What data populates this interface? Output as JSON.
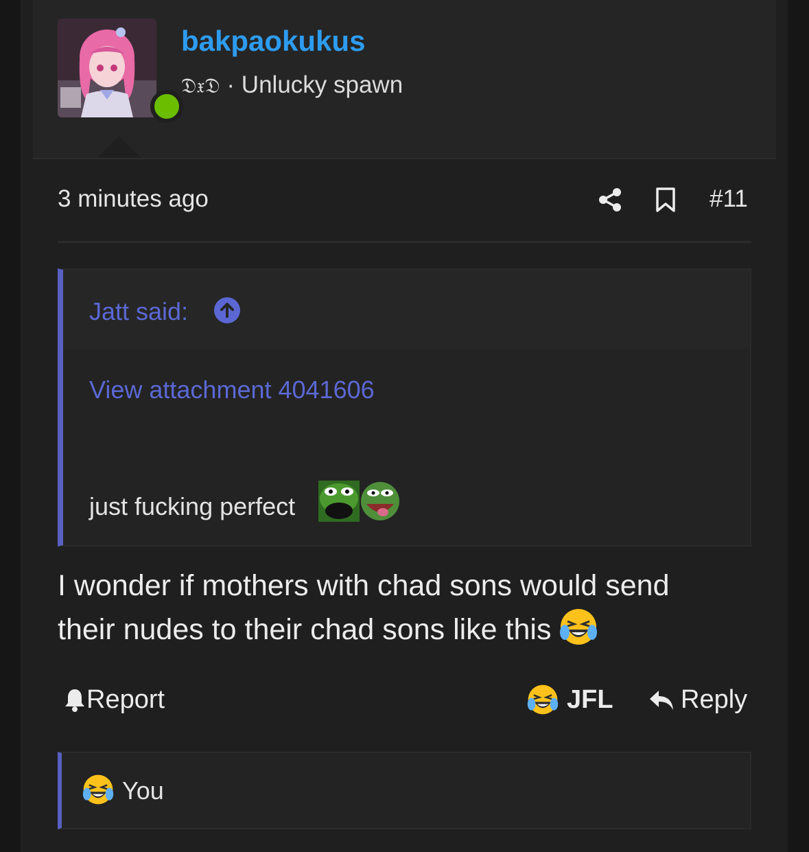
{
  "user": {
    "name": "bakpaokukus",
    "badge": "𝔇𝔵𝔇",
    "separator": "·",
    "title": "Unlucky spawn",
    "status_color": "#6bbd00"
  },
  "meta": {
    "time": "3 minutes ago",
    "post_number": "#11",
    "icons": [
      "share-icon",
      "bookmark-icon"
    ]
  },
  "quote": {
    "author": "Jatt said:",
    "attachment": "View attachment 4041606",
    "text": "just fucking perfect"
  },
  "body": {
    "line1": "I wonder if mothers with chad sons would send",
    "line2": "their nudes to their chad sons like this"
  },
  "actions": {
    "report": "Report",
    "jfl": "JFL",
    "reply": "Reply"
  },
  "reactions": {
    "label": "You"
  },
  "colors": {
    "accent": "#5860c2",
    "link": "#5b68d4",
    "username": "#2d9cf0"
  }
}
